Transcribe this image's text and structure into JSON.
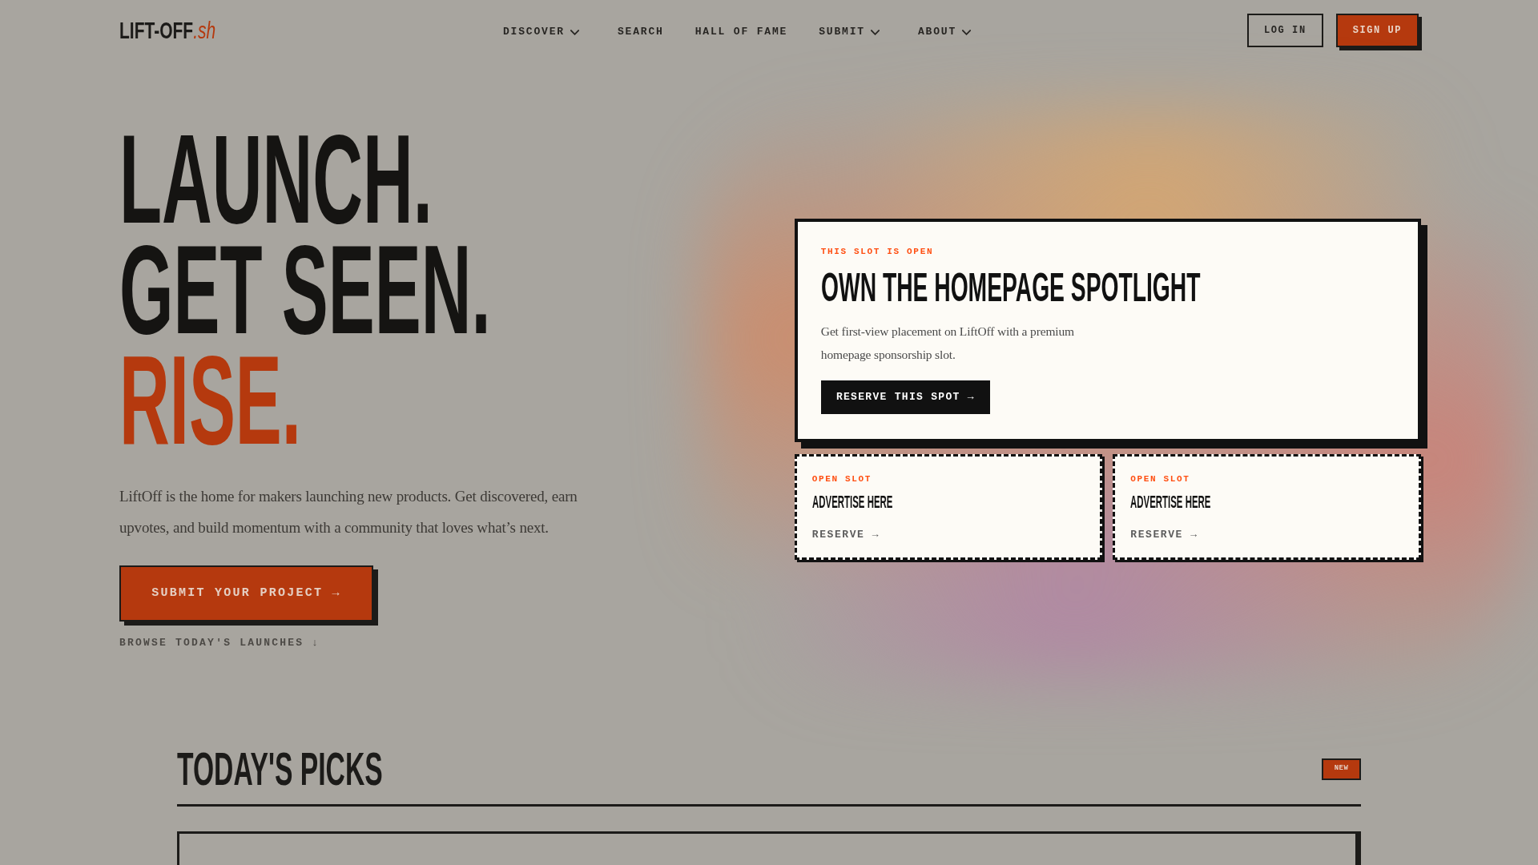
{
  "header": {
    "logo": {
      "name": "LIFT-OFF",
      "suffix": ".sh"
    },
    "nav": [
      {
        "label": "DISCOVER",
        "kind": "dropdown"
      },
      {
        "label": "SEARCH",
        "kind": "link"
      },
      {
        "label": "HALL OF FAME",
        "kind": "link"
      },
      {
        "label": "SUBMIT",
        "kind": "dropdown"
      },
      {
        "label": "ABOUT",
        "kind": "dropdown"
      }
    ],
    "actions": [
      {
        "label": "LOG IN",
        "kind": "outline"
      },
      {
        "label": "SIGN UP",
        "kind": "primary"
      }
    ]
  },
  "hero": {
    "headline": [
      {
        "text": "LAUNCH.",
        "accent": false
      },
      {
        "text": "GET SEEN.",
        "accent": false
      },
      {
        "text": "RISE.",
        "accent": true
      }
    ],
    "description": "LiftOff is the home for makers launching new products. Get discovered, earn upvotes, and build momentum with a community that loves what’s next.",
    "primary_button": "SUBMIT YOUR PROJECT →",
    "secondary_link": "BROWSE TODAY'S LAUNCHES ↓"
  },
  "spotlight": {
    "eyebrow": "THIS SLOT IS OPEN",
    "title": "OWN THE HOMEPAGE SPOTLIGHT",
    "description": "Get first-view placement on LiftOff with a premium homepage sponsorship slot.",
    "button": "RESERVE THIS SPOT →"
  },
  "ad_slots": [
    {
      "eyebrow": "OPEN SLOT",
      "title": "ADVERTISE HERE",
      "link": "RESERVE →"
    },
    {
      "eyebrow": "OPEN SLOT",
      "title": "ADVERTISE HERE",
      "link": "RESERVE →"
    }
  ],
  "todays_picks": {
    "title": "TODAY'S PICKS",
    "badge": "NEW"
  }
}
